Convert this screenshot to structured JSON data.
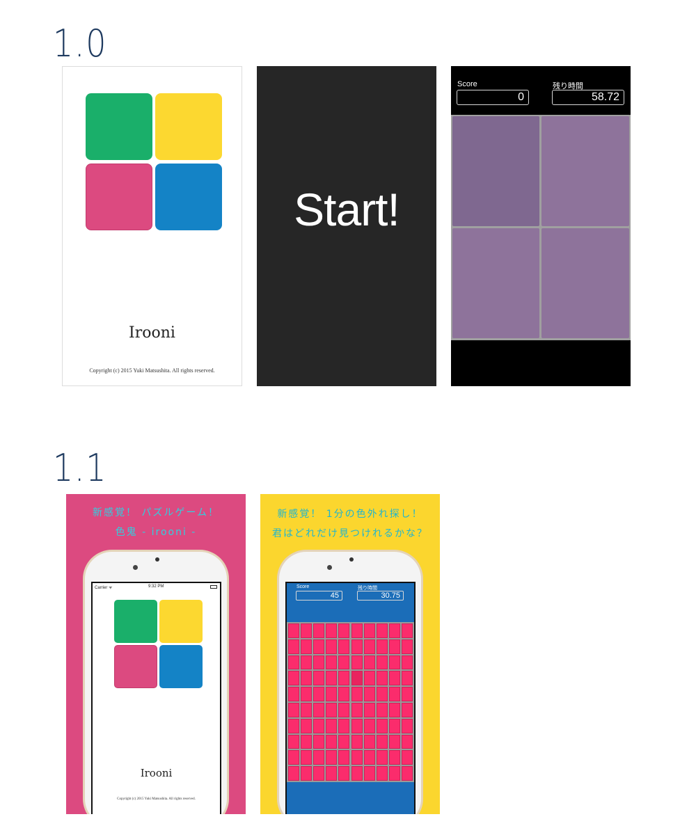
{
  "versions": {
    "v1": "1.0",
    "v2": "1.1"
  },
  "splash": {
    "app_name": "Irooni",
    "copyright": "Copyright (c) 2015 Yuki Matsushita. All rights reserved.",
    "colors": {
      "green": "#1aaf6a",
      "yellow": "#fcd830",
      "pink": "#dc4a80",
      "blue": "#1483c6"
    }
  },
  "start_screen": {
    "text": "Start!"
  },
  "game_screen": {
    "score_label": "Score",
    "score_value": "0",
    "time_label": "残り時間",
    "time_value": "58.72",
    "tile_color": "#8e739b",
    "odd_tile_color": "#7f6890"
  },
  "promo1": {
    "line1": "新感覚！ パズルゲーム！",
    "line2": "色鬼 - irooni -",
    "status_carrier": "Carrier ᯤ",
    "status_time": "9:32 PM",
    "app_name": "Irooni",
    "copyright": "Copyright (c) 2015 Yuki Matsushita. All rights reserved."
  },
  "promo2": {
    "line1": "新感覚！ 1分の色外れ探し！",
    "line2": "君はどれだけ見つけれるかな？",
    "score_label": "Score",
    "score_value": "45",
    "time_label": "残り時間",
    "time_value": "30.75",
    "grid": {
      "cols": 10,
      "rows": 10,
      "odd_row": 3,
      "odd_col": 5,
      "cell_color": "#fb2c6c",
      "odd_color": "#e9245f"
    }
  }
}
